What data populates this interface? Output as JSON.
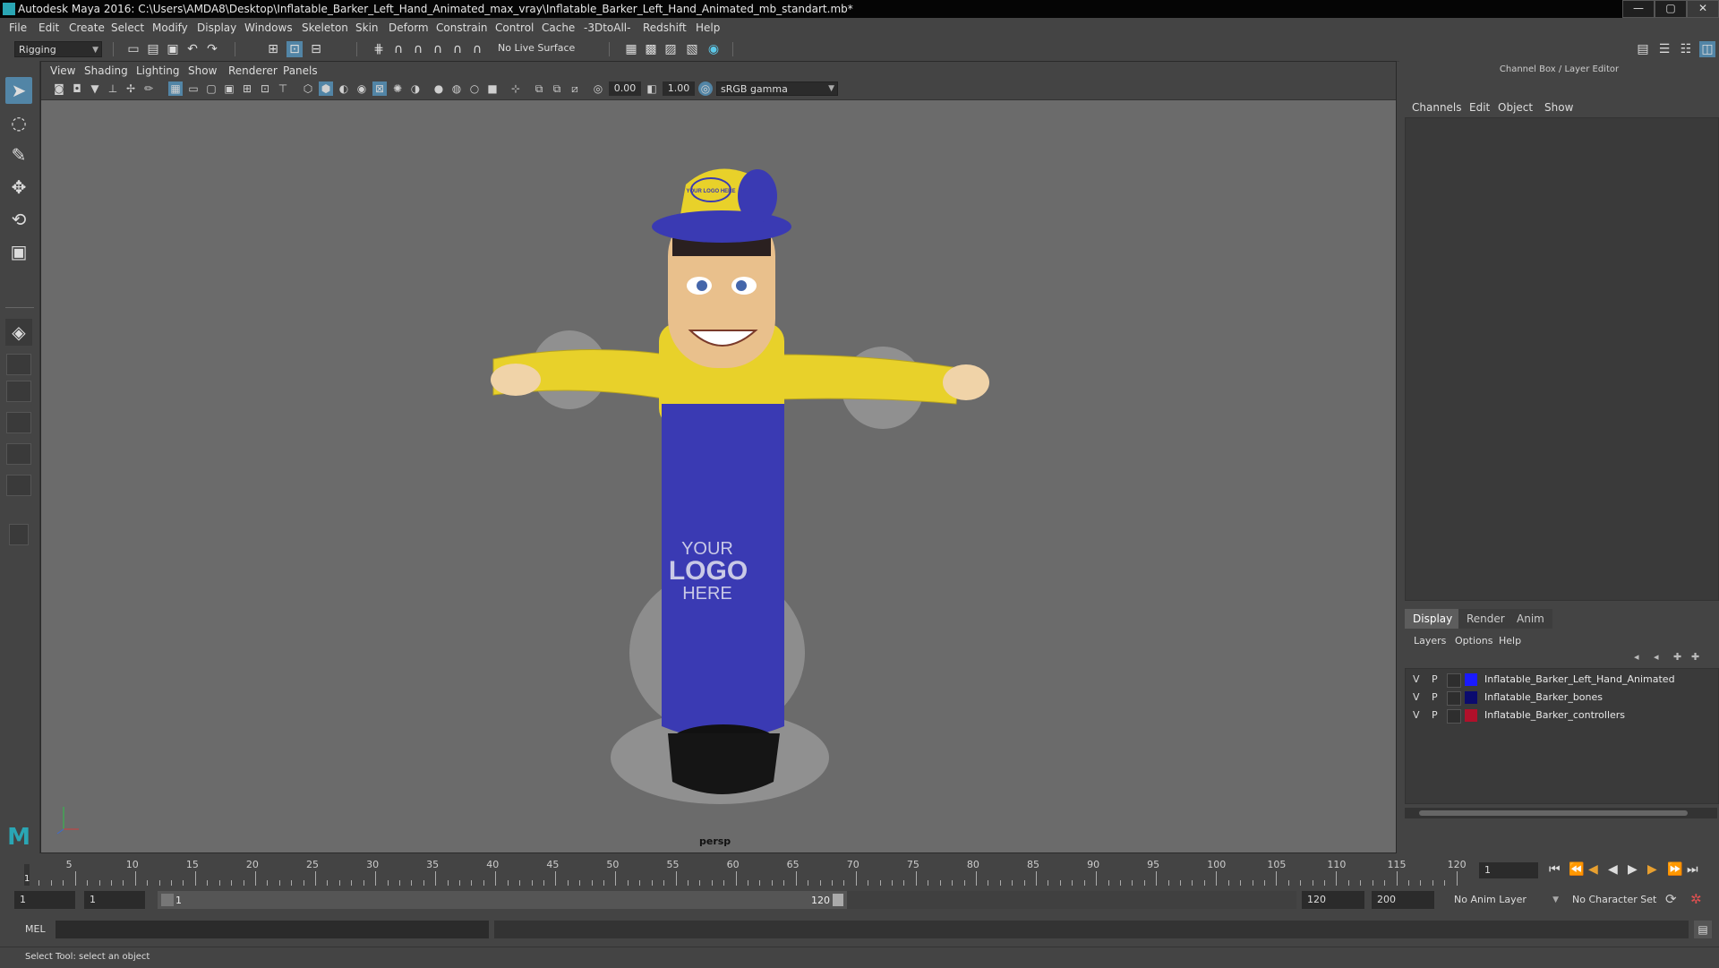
{
  "window": {
    "title": "Autodesk Maya 2016: C:\\Users\\AMDA8\\Desktop\\Inflatable_Barker_Left_Hand_Animated_max_vray\\Inflatable_Barker_Left_Hand_Animated_mb_standart.mb*",
    "minimize": "—",
    "maximize": "▢",
    "close": "✕"
  },
  "menubar": [
    "File",
    "Edit",
    "Create",
    "Select",
    "Modify",
    "Display",
    "Windows",
    "Skeleton",
    "Skin",
    "Deform",
    "Constrain",
    "Control",
    "Cache",
    "-3DtoAll-",
    "Redshift",
    "Help"
  ],
  "toolbar": {
    "mode": "Rigging",
    "live_surface": "No Live Surface"
  },
  "viewport": {
    "menu": [
      "View",
      "Shading",
      "Lighting",
      "Show",
      "Renderer",
      "Panels"
    ],
    "exposure": "0.00",
    "gamma": "1.00",
    "colorspace": "sRGB gamma",
    "camera_label": "persp"
  },
  "model_texts": {
    "cap_logo": "YOUR LOGO HERE",
    "body_logo_line1": "YOUR",
    "body_logo_line2": "LOGO",
    "body_logo_line3": "HERE"
  },
  "right_panel": {
    "title": "Channel Box / Layer Editor",
    "channel_menu": [
      "Channels",
      "Edit",
      "Object",
      "Show"
    ],
    "tabs": [
      "Display",
      "Render",
      "Anim"
    ],
    "layer_menu": [
      "Layers",
      "Options",
      "Help"
    ],
    "layers": [
      {
        "v": "V",
        "p": "P",
        "name": "Inflatable_Barker_Left_Hand_Animated",
        "color": "#1a1aff"
      },
      {
        "v": "V",
        "p": "P",
        "name": "Inflatable_Barker_bones",
        "color": "#0b0b6e"
      },
      {
        "v": "V",
        "p": "P",
        "name": "Inflatable_Barker_controllers",
        "color": "#b0102a"
      }
    ]
  },
  "timeline": {
    "ticks": [
      "5",
      "10",
      "15",
      "20",
      "25",
      "30",
      "35",
      "40",
      "45",
      "50",
      "55",
      "60",
      "65",
      "70",
      "75",
      "80",
      "85",
      "90",
      "95",
      "100",
      "105",
      "110",
      "115",
      "120"
    ],
    "current_marker": "1",
    "current_frame": "1"
  },
  "range": {
    "start": "1",
    "anim_start": "1",
    "slider_start": "1",
    "slider_end": "120",
    "end": "120",
    "anim_end": "200",
    "anim_layer": "No Anim Layer",
    "character_set": "No Character Set"
  },
  "command": {
    "lang": "MEL"
  },
  "status": {
    "message": "Select Tool: select an object"
  }
}
